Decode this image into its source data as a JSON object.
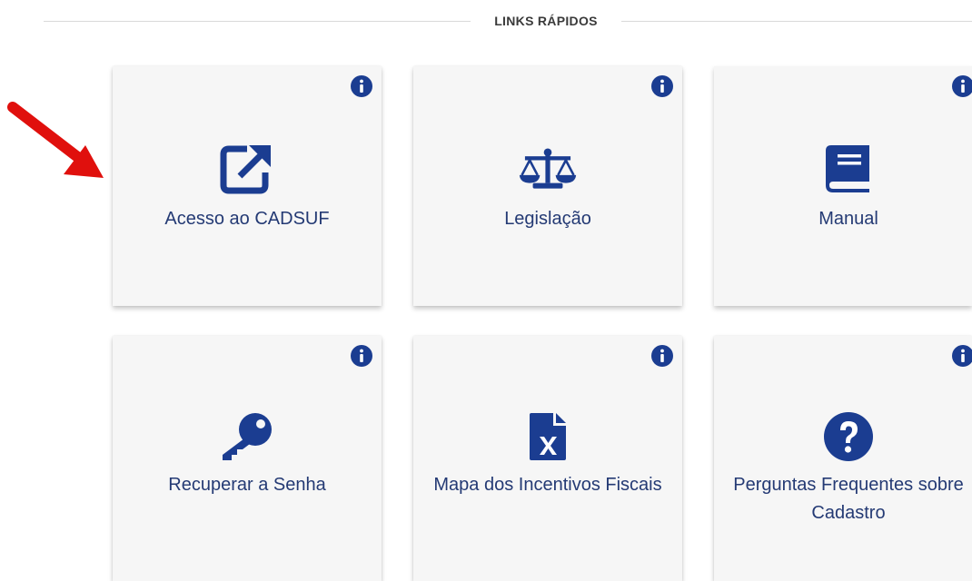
{
  "section": {
    "title": "LINKS RÁPIDOS"
  },
  "cards": [
    {
      "label": "Acesso ao CADSUF",
      "icon": "external-link-icon"
    },
    {
      "label": "Legislação",
      "icon": "scales-icon"
    },
    {
      "label": "Manual",
      "icon": "book-icon"
    },
    {
      "label": "Recuperar a Senha",
      "icon": "key-icon"
    },
    {
      "label": "Mapa dos Incentivos Fiscais",
      "icon": "excel-file-icon"
    },
    {
      "label": "Perguntas Frequentes sobre Cadastro",
      "icon": "question-circle-icon"
    }
  ],
  "colors": {
    "accent": "#1b3d91",
    "text": "#243a74",
    "card_bg": "#f6f6f6",
    "arrow": "#e0100d"
  }
}
